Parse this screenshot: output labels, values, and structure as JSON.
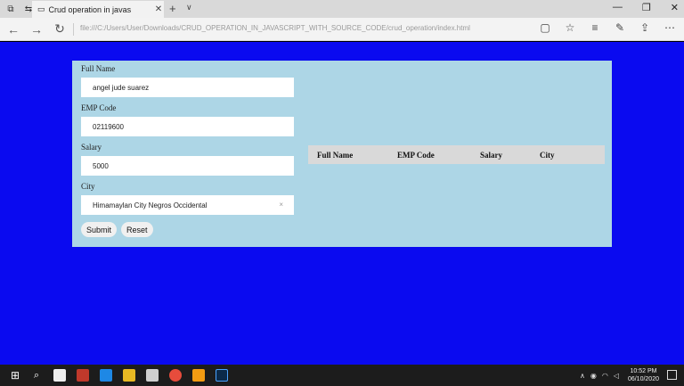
{
  "browser": {
    "tab_title": "Crud operation in javas",
    "tab_close": "✕",
    "new_tab": "+",
    "tab_menu": "∨",
    "url": "file:///C:/Users/User/Downloads/CRUD_OPERATION_IN_JAVASCRIPT_WITH_SOURCE_CODE/crud_operation/index.html",
    "window_controls": [
      "—",
      "❐",
      "✕"
    ],
    "nav": [
      "←",
      "→",
      "↻"
    ],
    "tools": [
      "▢",
      "☆",
      "≡",
      "✎",
      "⇪",
      "⋯"
    ]
  },
  "form": {
    "full_name_label": "Full Name",
    "full_name_value": "angel jude suarez",
    "emp_code_label": "EMP Code",
    "emp_code_value": "02119600",
    "salary_label": "Salary",
    "salary_value": "5000",
    "city_label": "City",
    "city_value": "Himamaylan City Negros Occidental",
    "city_clear": "×",
    "submit_label": "Submit",
    "reset_label": "Reset"
  },
  "table": {
    "headers": [
      "Full Name",
      "EMP Code",
      "Salary",
      "City"
    ]
  },
  "taskbar": {
    "time": "10:52 PM",
    "date": "06/10/2020"
  },
  "colors": {
    "page_background": "#0a0af0",
    "container_background": "#add6e6",
    "table_header_background": "#d9d9d9"
  }
}
